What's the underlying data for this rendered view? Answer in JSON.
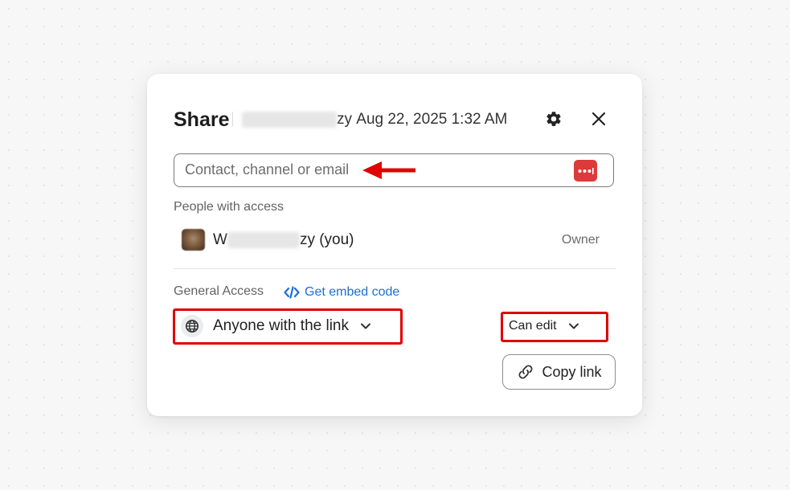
{
  "dialog": {
    "title": "Share",
    "subtitle": {
      "owner_visible_suffix": "zy",
      "date_text": "Aug 22, 2025 1:32 AM"
    },
    "settings_icon": "gear-icon",
    "close_icon": "close-icon"
  },
  "search": {
    "placeholder": "Contact, channel or email",
    "value": "",
    "password_manager_icon": "password-manager-icon"
  },
  "people": {
    "label": "People with access",
    "items": [
      {
        "name_prefix": "W",
        "name_suffix": "zy (you)",
        "role": "Owner"
      }
    ]
  },
  "general_access": {
    "label": "General Access",
    "embed_label": "Get embed code",
    "access_value": "Anyone with the link",
    "permission_value": "Can edit"
  },
  "copy_link": {
    "label": "Copy link"
  },
  "annotations": {
    "highlight_color": "#e00000",
    "arrow_color": "#e00000"
  },
  "colors": {
    "link": "#1a6fd6",
    "password_icon_bg": "#dc3b3b"
  }
}
